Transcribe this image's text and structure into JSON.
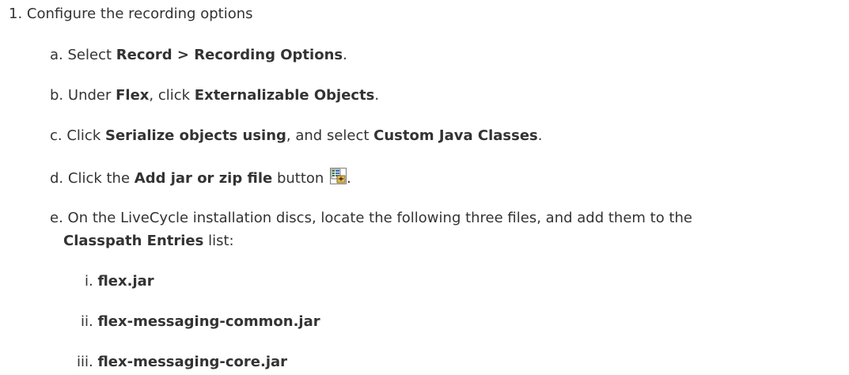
{
  "step": {
    "number": "1.",
    "title": "Configure the recording options"
  },
  "substeps": {
    "a": {
      "marker": "a.",
      "t1": "Select ",
      "b1": "Record > Recording Options",
      "t2": "."
    },
    "b": {
      "marker": "b.",
      "t1": "Under ",
      "b1": "Flex",
      "t2": ", click ",
      "b2": "Externalizable Objects",
      "t3": "."
    },
    "c": {
      "marker": "c.",
      "t1": "Click ",
      "b1": "Serialize objects using",
      "t2": ", and select ",
      "b2": "Custom Java Classes",
      "t3": "."
    },
    "d": {
      "marker": "d.",
      "t1": "Click the ",
      "b1": "Add jar or zip file",
      "t2": " button ",
      "icon": "add-jar-file-icon",
      "t3": "."
    },
    "e": {
      "marker": "e.",
      "t1": "On the LiveCycle installation discs, locate the following three files, and add them to the",
      "b1": "Classpath Entries",
      "t2": " list:"
    }
  },
  "files": [
    {
      "marker": "i.",
      "name": "flex.jar"
    },
    {
      "marker": "ii.",
      "name": "flex-messaging-common.jar"
    },
    {
      "marker": "iii.",
      "name": "flex-messaging-core.jar"
    }
  ]
}
